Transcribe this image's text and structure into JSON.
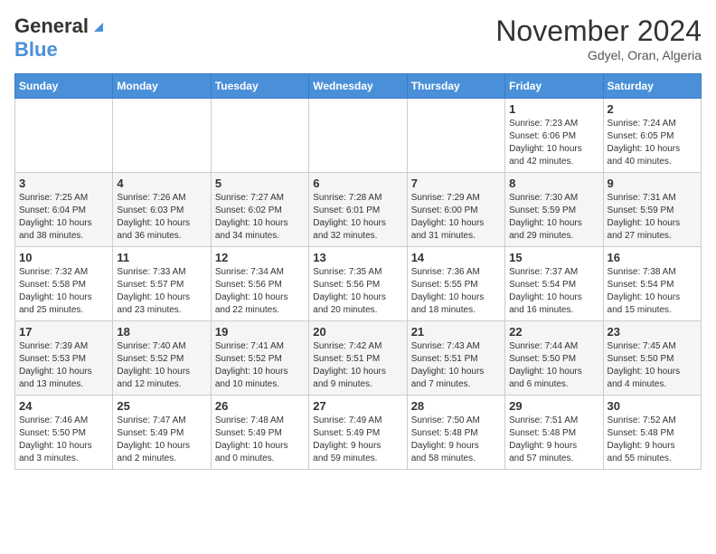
{
  "header": {
    "logo_general": "General",
    "logo_blue": "Blue",
    "month_title": "November 2024",
    "location": "Gdyel, Oran, Algeria"
  },
  "weekdays": [
    "Sunday",
    "Monday",
    "Tuesday",
    "Wednesday",
    "Thursday",
    "Friday",
    "Saturday"
  ],
  "weeks": [
    [
      {
        "day": "",
        "info": ""
      },
      {
        "day": "",
        "info": ""
      },
      {
        "day": "",
        "info": ""
      },
      {
        "day": "",
        "info": ""
      },
      {
        "day": "",
        "info": ""
      },
      {
        "day": "1",
        "info": "Sunrise: 7:23 AM\nSunset: 6:06 PM\nDaylight: 10 hours\nand 42 minutes."
      },
      {
        "day": "2",
        "info": "Sunrise: 7:24 AM\nSunset: 6:05 PM\nDaylight: 10 hours\nand 40 minutes."
      }
    ],
    [
      {
        "day": "3",
        "info": "Sunrise: 7:25 AM\nSunset: 6:04 PM\nDaylight: 10 hours\nand 38 minutes."
      },
      {
        "day": "4",
        "info": "Sunrise: 7:26 AM\nSunset: 6:03 PM\nDaylight: 10 hours\nand 36 minutes."
      },
      {
        "day": "5",
        "info": "Sunrise: 7:27 AM\nSunset: 6:02 PM\nDaylight: 10 hours\nand 34 minutes."
      },
      {
        "day": "6",
        "info": "Sunrise: 7:28 AM\nSunset: 6:01 PM\nDaylight: 10 hours\nand 32 minutes."
      },
      {
        "day": "7",
        "info": "Sunrise: 7:29 AM\nSunset: 6:00 PM\nDaylight: 10 hours\nand 31 minutes."
      },
      {
        "day": "8",
        "info": "Sunrise: 7:30 AM\nSunset: 5:59 PM\nDaylight: 10 hours\nand 29 minutes."
      },
      {
        "day": "9",
        "info": "Sunrise: 7:31 AM\nSunset: 5:59 PM\nDaylight: 10 hours\nand 27 minutes."
      }
    ],
    [
      {
        "day": "10",
        "info": "Sunrise: 7:32 AM\nSunset: 5:58 PM\nDaylight: 10 hours\nand 25 minutes."
      },
      {
        "day": "11",
        "info": "Sunrise: 7:33 AM\nSunset: 5:57 PM\nDaylight: 10 hours\nand 23 minutes."
      },
      {
        "day": "12",
        "info": "Sunrise: 7:34 AM\nSunset: 5:56 PM\nDaylight: 10 hours\nand 22 minutes."
      },
      {
        "day": "13",
        "info": "Sunrise: 7:35 AM\nSunset: 5:56 PM\nDaylight: 10 hours\nand 20 minutes."
      },
      {
        "day": "14",
        "info": "Sunrise: 7:36 AM\nSunset: 5:55 PM\nDaylight: 10 hours\nand 18 minutes."
      },
      {
        "day": "15",
        "info": "Sunrise: 7:37 AM\nSunset: 5:54 PM\nDaylight: 10 hours\nand 16 minutes."
      },
      {
        "day": "16",
        "info": "Sunrise: 7:38 AM\nSunset: 5:54 PM\nDaylight: 10 hours\nand 15 minutes."
      }
    ],
    [
      {
        "day": "17",
        "info": "Sunrise: 7:39 AM\nSunset: 5:53 PM\nDaylight: 10 hours\nand 13 minutes."
      },
      {
        "day": "18",
        "info": "Sunrise: 7:40 AM\nSunset: 5:52 PM\nDaylight: 10 hours\nand 12 minutes."
      },
      {
        "day": "19",
        "info": "Sunrise: 7:41 AM\nSunset: 5:52 PM\nDaylight: 10 hours\nand 10 minutes."
      },
      {
        "day": "20",
        "info": "Sunrise: 7:42 AM\nSunset: 5:51 PM\nDaylight: 10 hours\nand 9 minutes."
      },
      {
        "day": "21",
        "info": "Sunrise: 7:43 AM\nSunset: 5:51 PM\nDaylight: 10 hours\nand 7 minutes."
      },
      {
        "day": "22",
        "info": "Sunrise: 7:44 AM\nSunset: 5:50 PM\nDaylight: 10 hours\nand 6 minutes."
      },
      {
        "day": "23",
        "info": "Sunrise: 7:45 AM\nSunset: 5:50 PM\nDaylight: 10 hours\nand 4 minutes."
      }
    ],
    [
      {
        "day": "24",
        "info": "Sunrise: 7:46 AM\nSunset: 5:50 PM\nDaylight: 10 hours\nand 3 minutes."
      },
      {
        "day": "25",
        "info": "Sunrise: 7:47 AM\nSunset: 5:49 PM\nDaylight: 10 hours\nand 2 minutes."
      },
      {
        "day": "26",
        "info": "Sunrise: 7:48 AM\nSunset: 5:49 PM\nDaylight: 10 hours\nand 0 minutes."
      },
      {
        "day": "27",
        "info": "Sunrise: 7:49 AM\nSunset: 5:49 PM\nDaylight: 9 hours\nand 59 minutes."
      },
      {
        "day": "28",
        "info": "Sunrise: 7:50 AM\nSunset: 5:48 PM\nDaylight: 9 hours\nand 58 minutes."
      },
      {
        "day": "29",
        "info": "Sunrise: 7:51 AM\nSunset: 5:48 PM\nDaylight: 9 hours\nand 57 minutes."
      },
      {
        "day": "30",
        "info": "Sunrise: 7:52 AM\nSunset: 5:48 PM\nDaylight: 9 hours\nand 55 minutes."
      }
    ]
  ]
}
